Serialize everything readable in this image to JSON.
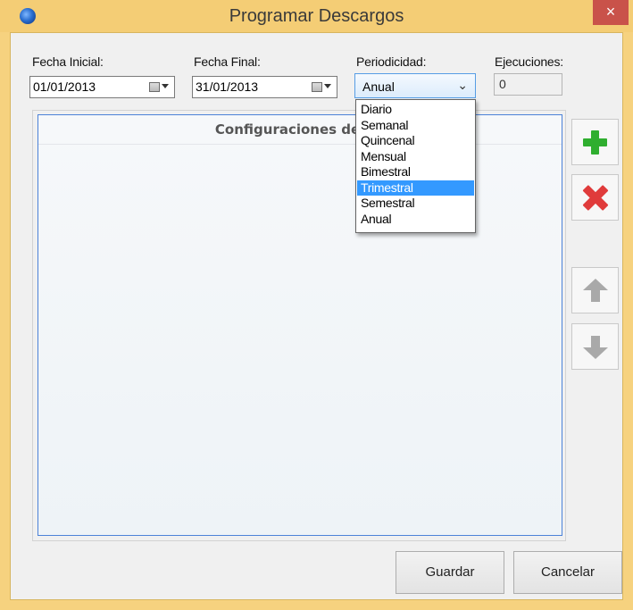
{
  "window": {
    "title": "Programar Descargos",
    "close_glyph": "×"
  },
  "form": {
    "fecha_inicial": {
      "label": "Fecha Inicial:",
      "value": "01/01/2013"
    },
    "fecha_final": {
      "label": "Fecha Final:",
      "value": "31/01/2013"
    },
    "periodicidad": {
      "label": "Periodicidad:",
      "value": "Anual",
      "chevron": "⌄",
      "options": [
        "Diario",
        "Semanal",
        "Quincenal",
        "Mensual",
        "Bimestral",
        "Trimestral",
        "Semestral",
        "Anual"
      ],
      "highlighted": "Trimestral"
    },
    "ejecuciones": {
      "label": "Ejecuciones:",
      "value": "0"
    }
  },
  "grid": {
    "header": "Configuraciones de De"
  },
  "toolbar": {
    "add_icon": "plus-icon",
    "delete_icon": "x-icon",
    "up_icon": "arrow-up-icon",
    "down_icon": "arrow-down-icon"
  },
  "buttons": {
    "save": "Guardar",
    "cancel": "Cancelar"
  },
  "colors": {
    "titlebar": "#f4cd75",
    "close": "#c9524a",
    "selection": "#3399ff",
    "add": "#2fae2f",
    "delete": "#e03b3b"
  }
}
